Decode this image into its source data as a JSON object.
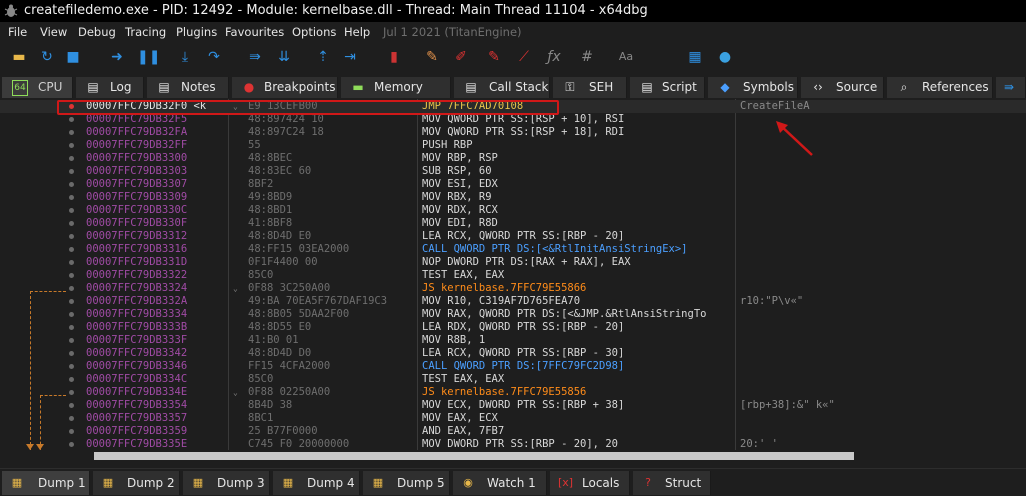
{
  "window": {
    "title": "createfiledemo.exe - PID: 12492 - Module: kernelbase.dll - Thread: Main Thread 11104 - x64dbg"
  },
  "menu": {
    "items": [
      "File",
      "View",
      "Debug",
      "Tracing",
      "Plugins",
      "Favourites",
      "Options",
      "Help"
    ],
    "date": "Jul 1 2021 (TitanEngine)"
  },
  "toolbar": {
    "icons": [
      "open-icon",
      "restart-icon",
      "close-icon",
      "run-icon",
      "pause-icon",
      "step-into-icon",
      "step-over-icon",
      "trace-into-icon",
      "trace-over-icon",
      "execute-till-return-icon",
      "run-to-user-code-icon",
      "scylla-icon",
      "patch-icon",
      "comment-icon",
      "label-icon",
      "bookmark-icon",
      "function-icon",
      "hash-icon",
      "font-icon",
      "settings-icon",
      "globe-icon"
    ]
  },
  "tabs": [
    "CPU",
    "Log",
    "Notes",
    "Breakpoints",
    "Memory Map",
    "Call Stack",
    "SEH",
    "Script",
    "Symbols",
    "Source",
    "References"
  ],
  "rows": [
    {
      "addr": "00007FFC79DB32F0 <k",
      "arrow": "⌄",
      "bytes": "E9 13CEFB00",
      "disasm": "JMP 7FFC7AD70108",
      "kind": "jmp",
      "comment": "CreateFileA",
      "bp": "red"
    },
    {
      "addr": "00007FFC79DB32F5",
      "arrow": "",
      "bytes": "48:897424 10",
      "disasm": "MOV QWORD PTR SS:[RSP + 10], RSI",
      "kind": "",
      "comment": "",
      "bp": "grey"
    },
    {
      "addr": "00007FFC79DB32FA",
      "arrow": "",
      "bytes": "48:897C24 18",
      "disasm": "MOV QWORD PTR SS:[RSP + 18], RDI",
      "kind": "",
      "comment": "",
      "bp": "grey"
    },
    {
      "addr": "00007FFC79DB32FF",
      "arrow": "",
      "bytes": "55",
      "disasm": "PUSH RBP",
      "kind": "",
      "comment": "",
      "bp": "grey"
    },
    {
      "addr": "00007FFC79DB3300",
      "arrow": "",
      "bytes": "48:8BEC",
      "disasm": "MOV RBP, RSP",
      "kind": "",
      "comment": "",
      "bp": "grey"
    },
    {
      "addr": "00007FFC79DB3303",
      "arrow": "",
      "bytes": "48:83EC 60",
      "disasm": "SUB RSP, 60",
      "kind": "",
      "comment": "",
      "bp": "grey"
    },
    {
      "addr": "00007FFC79DB3307",
      "arrow": "",
      "bytes": "8BF2",
      "disasm": "MOV ESI, EDX",
      "kind": "",
      "comment": "",
      "bp": "grey"
    },
    {
      "addr": "00007FFC79DB3309",
      "arrow": "",
      "bytes": "49:8BD9",
      "disasm": "MOV RBX, R9",
      "kind": "",
      "comment": "",
      "bp": "grey"
    },
    {
      "addr": "00007FFC79DB330C",
      "arrow": "",
      "bytes": "48:8BD1",
      "disasm": "MOV RDX, RCX",
      "kind": "",
      "comment": "",
      "bp": "grey"
    },
    {
      "addr": "00007FFC79DB330F",
      "arrow": "",
      "bytes": "41:8BF8",
      "disasm": "MOV EDI, R8D",
      "kind": "",
      "comment": "",
      "bp": "grey"
    },
    {
      "addr": "00007FFC79DB3312",
      "arrow": "",
      "bytes": "48:8D4D E0",
      "disasm": "LEA RCX, QWORD PTR SS:[RBP - 20]",
      "kind": "",
      "comment": "",
      "bp": "grey"
    },
    {
      "addr": "00007FFC79DB3316",
      "arrow": "",
      "bytes": "48:FF15 03EA2000",
      "disasm": "CALL QWORD PTR DS:[<&RtlInitAnsiStringEx>]",
      "kind": "call",
      "comment": "",
      "bp": "grey"
    },
    {
      "addr": "00007FFC79DB331D",
      "arrow": "",
      "bytes": "0F1F4400 00",
      "disasm": "NOP DWORD PTR DS:[RAX + RAX], EAX",
      "kind": "",
      "comment": "",
      "bp": "grey"
    },
    {
      "addr": "00007FFC79DB3322",
      "arrow": "",
      "bytes": "85C0",
      "disasm": "TEST EAX, EAX",
      "kind": "",
      "comment": "",
      "bp": "grey"
    },
    {
      "addr": "00007FFC79DB3324",
      "arrow": "⌄",
      "bytes": "0F88 3C250A00",
      "disasm": "JS kernelbase.7FFC79E55866",
      "kind": "jcc",
      "comment": "",
      "bp": "grey"
    },
    {
      "addr": "00007FFC79DB332A",
      "arrow": "",
      "bytes": "49:BA 70EA5F767DAF19C3",
      "disasm": "MOV R10, C319AF7D765FEA70",
      "kind": "",
      "comment": "r10:\"P\\v«\"",
      "bp": "grey"
    },
    {
      "addr": "00007FFC79DB3334",
      "arrow": "",
      "bytes": "48:8B05 5DAA2F00",
      "disasm": "MOV RAX, QWORD PTR DS:[<&JMP.&RtlAnsiStringTo",
      "kind": "",
      "comment": "",
      "bp": "grey"
    },
    {
      "addr": "00007FFC79DB333B",
      "arrow": "",
      "bytes": "48:8D55 E0",
      "disasm": "LEA RDX, QWORD PTR SS:[RBP - 20]",
      "kind": "",
      "comment": "",
      "bp": "grey"
    },
    {
      "addr": "00007FFC79DB333F",
      "arrow": "",
      "bytes": "41:B0 01",
      "disasm": "MOV R8B, 1",
      "kind": "",
      "comment": "",
      "bp": "grey"
    },
    {
      "addr": "00007FFC79DB3342",
      "arrow": "",
      "bytes": "48:8D4D D0",
      "disasm": "LEA RCX, QWORD PTR SS:[RBP - 30]",
      "kind": "",
      "comment": "",
      "bp": "grey"
    },
    {
      "addr": "00007FFC79DB3346",
      "arrow": "",
      "bytes": "FF15 4CFA2000",
      "disasm": "CALL QWORD PTR DS:[7FFC79FC2D98]",
      "kind": "call",
      "comment": "",
      "bp": "grey"
    },
    {
      "addr": "00007FFC79DB334C",
      "arrow": "",
      "bytes": "85C0",
      "disasm": "TEST EAX, EAX",
      "kind": "",
      "comment": "",
      "bp": "grey"
    },
    {
      "addr": "00007FFC79DB334E",
      "arrow": "⌄",
      "bytes": "0F88 02250A00",
      "disasm": "JS kernelbase.7FFC79E55856",
      "kind": "jcc",
      "comment": "",
      "bp": "grey"
    },
    {
      "addr": "00007FFC79DB3354",
      "arrow": "",
      "bytes": "8B4D 38",
      "disasm": "MOV ECX, DWORD PTR SS:[RBP + 38]",
      "kind": "",
      "comment": "[rbp+38]:&\" k«\"",
      "bp": "grey"
    },
    {
      "addr": "00007FFC79DB3357",
      "arrow": "",
      "bytes": "8BC1",
      "disasm": "MOV EAX, ECX",
      "kind": "",
      "comment": "",
      "bp": "grey"
    },
    {
      "addr": "00007FFC79DB3359",
      "arrow": "",
      "bytes": "25 B77F0000",
      "disasm": "AND EAX, 7FB7",
      "kind": "",
      "comment": "",
      "bp": "grey"
    },
    {
      "addr": "00007FFC79DB335E",
      "arrow": "",
      "bytes": "C745 F0 20000000",
      "disasm": "MOV DWORD PTR SS:[RBP - 20], 20",
      "kind": "",
      "comment": "20:' '",
      "bp": "grey"
    }
  ],
  "bottom_tabs": [
    "Dump 1",
    "Dump 2",
    "Dump 3",
    "Dump 4",
    "Dump 5",
    "Watch 1",
    "Locals",
    "Struct"
  ],
  "colors": {
    "highlight_box": "#d01818",
    "address": "#a04ba5",
    "jump": "#e8c34b",
    "call": "#4b9fff",
    "conditional_jump": "#ff8c1a"
  }
}
